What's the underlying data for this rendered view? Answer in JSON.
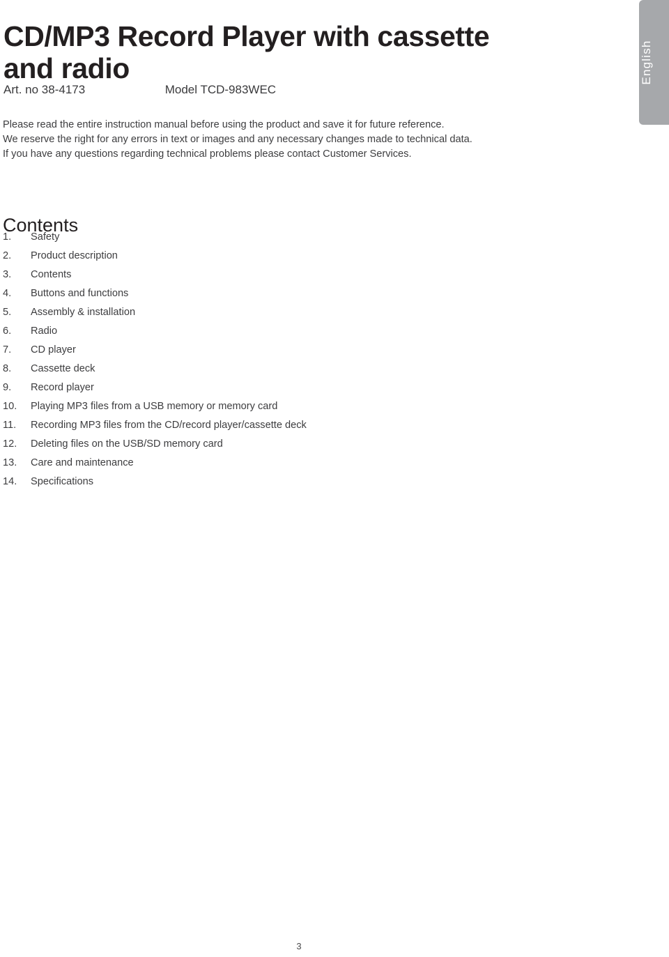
{
  "document": {
    "title_line1": "CD/MP3 Record Player with cassette",
    "title_line2": "and radio",
    "art_no": "Art. no 38-4173",
    "model": "Model TCD-983WEC",
    "language_tab": "English",
    "page_number": "3"
  },
  "intro": {
    "line1": "Please read the entire instruction manual before using the product and save it for future reference.",
    "line2": "We reserve the right for any errors in text or images and any necessary changes made to technical data.",
    "line3": "If you have any questions regarding technical problems please contact Customer Services."
  },
  "contents": {
    "heading": "Contents",
    "items": [
      {
        "num": "1.",
        "label": "Safety"
      },
      {
        "num": "2.",
        "label": "Product description"
      },
      {
        "num": "3.",
        "label": "Contents"
      },
      {
        "num": "4.",
        "label": "Buttons and functions"
      },
      {
        "num": "5.",
        "label": "Assembly & installation"
      },
      {
        "num": "6.",
        "label": "Radio"
      },
      {
        "num": "7.",
        "label": "CD player"
      },
      {
        "num": "8.",
        "label": "Cassette deck"
      },
      {
        "num": "9.",
        "label": "Record player"
      },
      {
        "num": "10.",
        "label": "Playing MP3 files from a USB memory or memory card"
      },
      {
        "num": "11.",
        "label": "Recording MP3 files from the CD/record player/cassette deck"
      },
      {
        "num": "12.",
        "label": "Deleting files on the USB/SD memory card"
      },
      {
        "num": "13.",
        "label": "Care and maintenance"
      },
      {
        "num": "14.",
        "label": "Specifications"
      }
    ]
  },
  "colors": {
    "tab_grey": "#a6a8ab",
    "text_dark": "#231f20",
    "text_body": "#3d3d3f"
  }
}
